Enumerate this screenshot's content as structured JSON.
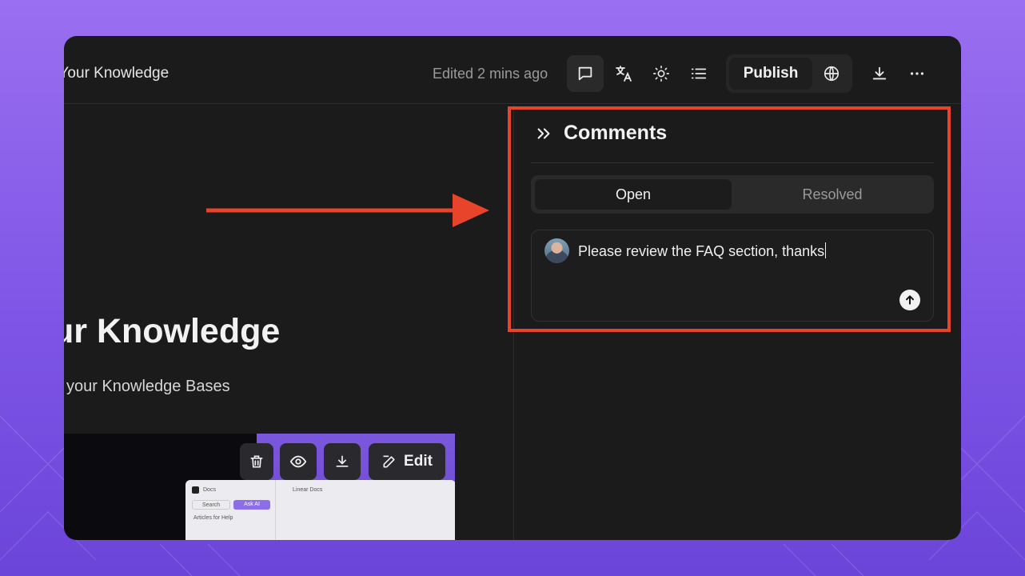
{
  "header": {
    "doc_title": "g Your Knowledge",
    "edited_status": "Edited 2 mins ago",
    "publish_label": "Publish",
    "icons": [
      "comment-icon",
      "translate-icon",
      "theme-icon",
      "outline-icon",
      "globe-icon",
      "download-icon",
      "more-icon"
    ]
  },
  "document": {
    "heading": "ur Knowledge",
    "subheading": "your Knowledge Bases",
    "media_toolbar": {
      "edit_label": "Edit"
    },
    "preview": {
      "sidebar_title": "Docs",
      "search_label": "Search",
      "ask_ai_label": "Ask AI",
      "section_label": "Articles for Help",
      "breadcrumb": "Linear Docs"
    }
  },
  "comments": {
    "title": "Comments",
    "tabs": [
      {
        "label": "Open",
        "active": true
      },
      {
        "label": "Resolved",
        "active": false
      }
    ],
    "input_value": "Please review the FAQ section, thanks"
  },
  "annotation": {
    "highlight_color": "#e8432b"
  },
  "colors": {
    "accent": "#7b57dd",
    "window_bg": "#1b1b1b"
  }
}
